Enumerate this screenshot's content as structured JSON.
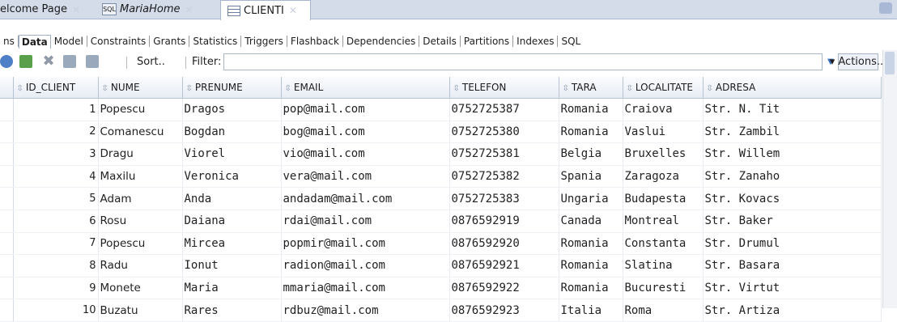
{
  "doc_tabs": [
    {
      "label": "elcome Page",
      "active": false
    },
    {
      "label": "MariaHome",
      "active": false,
      "icon": "sql-worksheet-icon"
    },
    {
      "label": "CLIENTI",
      "active": true,
      "icon": "table-icon"
    }
  ],
  "sub_tabs": [
    "ns",
    "Data",
    "Model",
    "Constraints",
    "Grants",
    "Statistics",
    "Triggers",
    "Flashback",
    "Dependencies",
    "Details",
    "Partitions",
    "Indexes",
    "SQL"
  ],
  "active_sub_tab": "Data",
  "toolbar": {
    "sort_label": "Sort..",
    "filter_label": "Filter:",
    "filter_value": "",
    "actions_label": "▾ Actions..."
  },
  "columns": [
    "ID_CLIENT",
    "NUME",
    "PRENUME",
    "EMAIL",
    "TELEFON",
    "TARA",
    "LOCALITATE",
    "ADRESA"
  ],
  "rows": [
    [
      "1",
      "Popescu",
      "Dragos",
      "pop@mail.com",
      "0752725387",
      "Romania",
      "Craiova",
      "Str. N. Tit"
    ],
    [
      "2",
      "Comanescu",
      "Bogdan",
      "bog@mail.com",
      "0752725380",
      "Romania",
      "Vaslui",
      "Str. Zambil"
    ],
    [
      "3",
      "Dragu",
      "Viorel",
      "vio@mail.com",
      "0752725381",
      "Belgia",
      "Bruxelles",
      "Str. Willem"
    ],
    [
      "4",
      "Maxilu",
      "Veronica",
      "vera@mail.com",
      "0752725382",
      "Spania",
      "Zaragoza",
      "Str. Zanaho"
    ],
    [
      "5",
      "Adam",
      "Anda",
      "andadam@mail.com",
      "0752725383",
      "Ungaria",
      "Budapesta",
      "Str. Kovacs"
    ],
    [
      "6",
      "Rosu",
      "Daiana",
      "rdai@mail.com",
      "0876592919",
      "Canada",
      "Montreal",
      "Str. Baker"
    ],
    [
      "7",
      "Popescu",
      "Mircea",
      "popmir@mail.com",
      "0876592920",
      "Romania",
      "Constanta",
      "Str. Drumul"
    ],
    [
      "8",
      "Radu",
      "Ionut",
      "radion@mail.com",
      "0876592921",
      "Romania",
      "Slatina",
      "Str. Basara"
    ],
    [
      "9",
      "Monete",
      "Maria",
      "mmaria@mail.com",
      "0876592922",
      "Romania",
      "Bucuresti",
      "Str. Virtut"
    ],
    [
      "10",
      "Buzatu",
      "Rares",
      "rdbuz@mail.com",
      "0876592923",
      "Italia",
      "Roma",
      "Str. Artiza"
    ]
  ],
  "colors": {
    "accent": "#3c6fc4",
    "tab_bar": "#d4dcea",
    "header_bg": "#e7ecf4"
  }
}
